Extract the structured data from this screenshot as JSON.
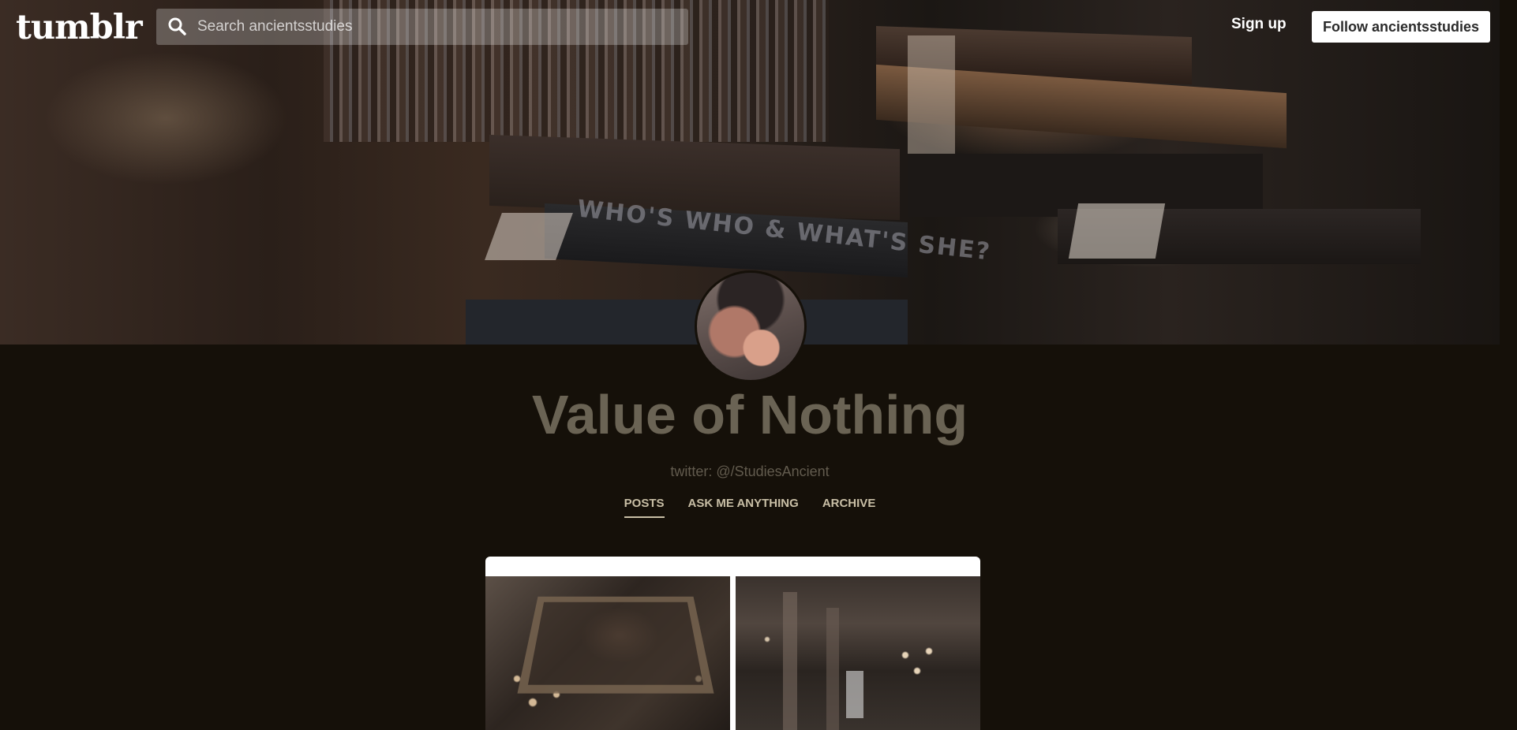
{
  "nav": {
    "logo": "tumblr",
    "search_placeholder": "Search ancientsstudies",
    "signup_label": "Sign up",
    "follow_label": "Follow ancientsstudies"
  },
  "banner": {
    "spine_text": "WHO'S WHO & WHAT'S SHE?"
  },
  "blog": {
    "title": "Value of Nothing",
    "description": "twitter: @/StudiesAncient",
    "tabs": [
      {
        "label": "POSTS",
        "active": true
      },
      {
        "label": "ASK ME ANYTHING",
        "active": false
      },
      {
        "label": "ARCHIVE",
        "active": false
      }
    ]
  },
  "colors": {
    "background": "#151009",
    "title": "#6a6354",
    "tab_text": "#c9bfa6"
  },
  "icons": {
    "search": "search-icon"
  }
}
